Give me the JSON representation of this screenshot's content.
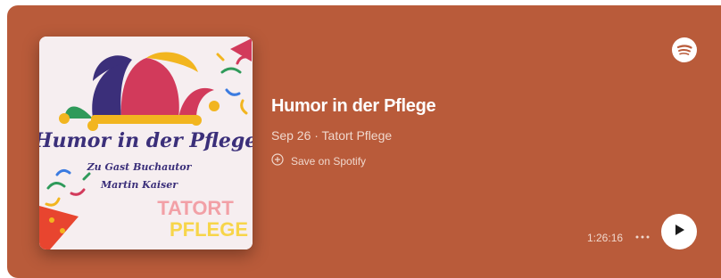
{
  "episode": {
    "title": "Humor in der Pflege",
    "subtitle": "Sep 26 · Tatort Pflege",
    "save_label": "Save on Spotify",
    "duration": "1:26:16"
  },
  "cover": {
    "heading": "Humor in der Pflege",
    "line1": "Zu Gast Buchautor",
    "line2": "Martin Kaiser",
    "brand1": "TATORT",
    "brand2": "PFLEGE"
  },
  "icons": {
    "spotify": "spotify-logo-icon",
    "save": "plus-circle-icon",
    "more": "more-dots-icon",
    "play": "play-icon"
  },
  "colors": {
    "card": "#b95b3a",
    "text_primary": "#ffffff",
    "text_secondary": "#f0d8cd",
    "cover_bg": "#f6eef0"
  }
}
